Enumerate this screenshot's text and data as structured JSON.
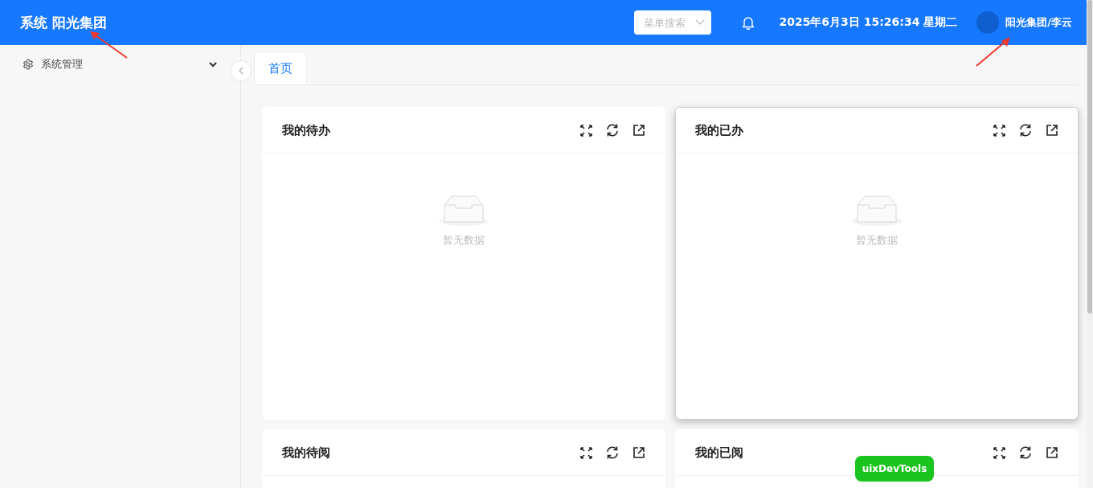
{
  "header": {
    "title": "系统 阳光集团",
    "search": {
      "placeholder": "菜单搜索"
    },
    "datetime": "2025年6月3日 15:26:34 星期二",
    "user": "阳光集团/李云"
  },
  "sidebar": {
    "items": [
      {
        "label": "系统管理",
        "expanded": false
      }
    ]
  },
  "tabs": [
    {
      "label": "首页",
      "selected": true
    }
  ],
  "cards": [
    {
      "title": "我的待办",
      "empty_text": "暂无数据",
      "highlighted": false
    },
    {
      "title": "我的已办",
      "empty_text": "暂无数据",
      "highlighted": true
    },
    {
      "title": "我的待阅",
      "highlighted": false
    },
    {
      "title": "我的已阅",
      "highlighted": false
    }
  ],
  "devtools_button": "uixDevTools"
}
